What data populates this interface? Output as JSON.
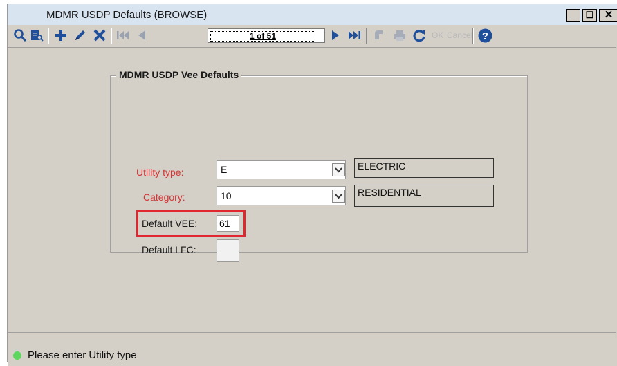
{
  "window": {
    "title": "MDMR USDP Defaults (BROWSE)",
    "minimize": "_",
    "maximize": "☐",
    "close": "✕"
  },
  "toolbar": {
    "record_position": "1 of 51",
    "ok_label": "OK",
    "cancel_label": "Cancel",
    "icons": [
      "search-icon",
      "query-icon",
      "add-icon",
      "edit-icon",
      "delete-icon",
      "first-record-icon",
      "previous-record-icon",
      "next-record-icon",
      "last-record-icon",
      "attach-icon",
      "print-icon",
      "refresh-icon",
      "help-icon"
    ]
  },
  "form": {
    "group_title": "MDMR USDP Vee Defaults",
    "utility_type": {
      "label": "Utility type:",
      "value": "E",
      "description": "ELECTRIC"
    },
    "category": {
      "label": "Category:",
      "value": "10",
      "description": "RESIDENTIAL"
    },
    "default_vee": {
      "label": "Default VEE:",
      "value": "61"
    },
    "default_lfc": {
      "label": "Default LFC:",
      "value": ""
    }
  },
  "status": {
    "message": "Please enter Utility type"
  },
  "colors": {
    "required_label": "#d33434",
    "highlight": "#e0262e",
    "toolbar_icon": "#1f4f9a",
    "status_ok": "#5cd65c"
  }
}
